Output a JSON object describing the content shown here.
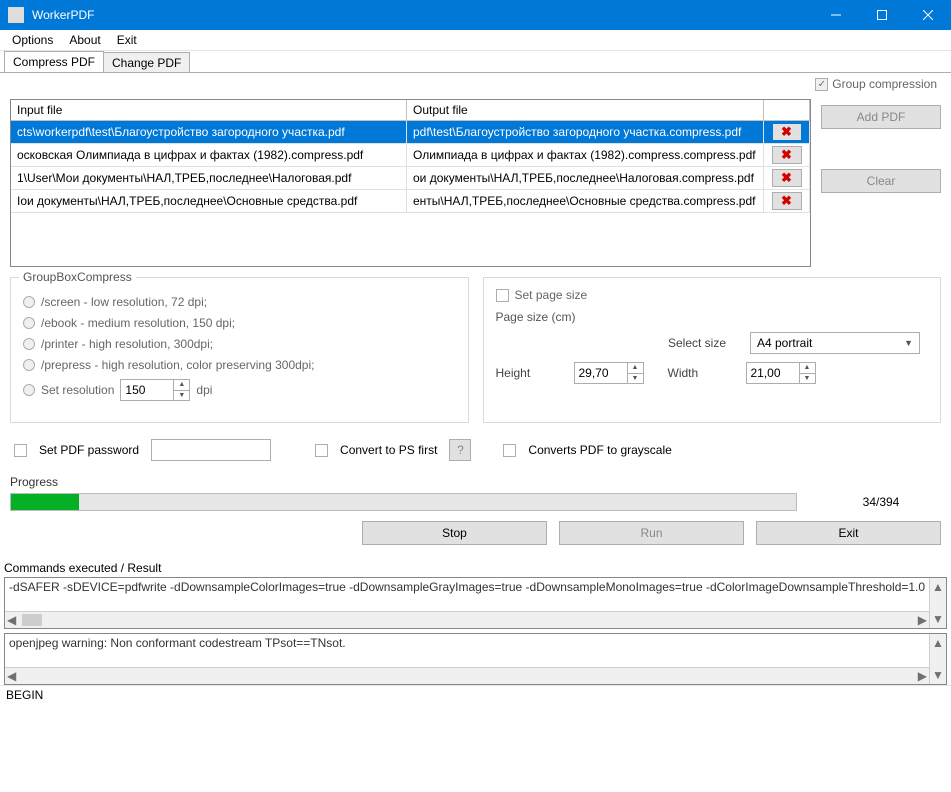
{
  "window": {
    "title": "WorkerPDF"
  },
  "menu": {
    "options": "Options",
    "about": "About",
    "exit": "Exit"
  },
  "tabs": {
    "compress": "Compress PDF",
    "change": "Change PDF"
  },
  "group_compression_label": "Group compression",
  "table": {
    "head_input": "Input file",
    "head_output": "Output file",
    "rows": [
      {
        "in": "cts\\workerpdf\\test\\Благоустройство загородного участка.pdf",
        "out": "pdf\\test\\Благоустройство загородного участка.compress.pdf"
      },
      {
        "in": "осковская Олимпиада в цифрах и фактах (1982).compress.pdf",
        "out": "Олимпиада в цифрах и фактах (1982).compress.compress.pdf"
      },
      {
        "in": "1\\User\\Мои документы\\НАЛ,ТРЕБ,последнее\\Налоговая.pdf",
        "out": "ои документы\\НАЛ,ТРЕБ,последнее\\Налоговая.compress.pdf"
      },
      {
        "in": "Iои документы\\НАЛ,ТРЕБ,последнее\\Основные средства.pdf",
        "out": "енты\\НАЛ,ТРЕБ,последнее\\Основные средства.compress.pdf"
      }
    ]
  },
  "buttons": {
    "add_pdf": "Add PDF",
    "clear": "Clear",
    "stop": "Stop",
    "run": "Run",
    "exit": "Exit"
  },
  "compress_group": {
    "legend": "GroupBoxCompress",
    "screen": "/screen - low resolution, 72 dpi;",
    "ebook": "/ebook - medium resolution, 150 dpi;",
    "printer": "/printer - high resolution, 300dpi;",
    "prepress": "/prepress - high resolution, color preserving 300dpi;",
    "setres": "Set resolution",
    "dpi_value": "150",
    "dpi_suffix": "dpi"
  },
  "pagesize": {
    "set_label": "Set page size",
    "section": "Page size (cm)",
    "select_label": "Select size",
    "select_value": "A4 portrait",
    "height_label": "Height",
    "height_value": "29,70",
    "width_label": "Width",
    "width_value": "21,00"
  },
  "opts": {
    "set_password": "Set PDF password",
    "convert_ps": "Convert to PS first",
    "q": "?",
    "grayscale": "Converts PDF to grayscale"
  },
  "progress": {
    "label": "Progress",
    "text": "34/394"
  },
  "commands": {
    "label": "Commands executed / Result",
    "line": "-dSAFER -sDEVICE=pdfwrite -dDownsampleColorImages=true -dDownsampleGrayImages=true -dDownsampleMonoImages=true -dColorImageDownsampleThreshold=1.0",
    "result": "openjpeg warning: Non conformant codestream TPsot==TNsot."
  },
  "status": "BEGIN"
}
